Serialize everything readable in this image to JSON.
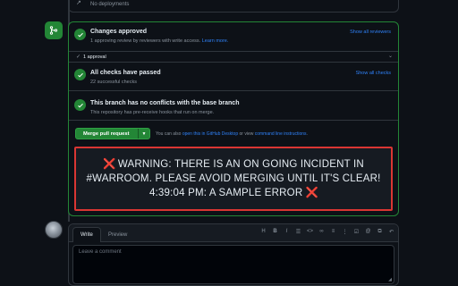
{
  "deployments": {
    "label": "No deployments"
  },
  "merge_box": {
    "approval": {
      "title": "Changes approved",
      "subtitle": "1 approving review by reviewers with write access.",
      "learn_more": "Learn more.",
      "show_all": "Show all reviewers",
      "count_label": "1 approval"
    },
    "checks": {
      "title": "All checks have passed",
      "subtitle": "22 successful checks",
      "show_all": "Show all checks"
    },
    "conflicts": {
      "title": "This branch has no conflicts with the base branch",
      "subtitle": "This repository has pre-receive hooks that run on merge."
    },
    "merge_button": {
      "label": "Merge pull request"
    },
    "alt_text": {
      "prefix": "You can also",
      "desktop_link": "open this in GitHub Desktop",
      "middle": "or view",
      "cli_link": "command line instructions",
      "suffix": "."
    },
    "warning": {
      "marks": "❌",
      "line1": "WARNING: THERE IS AN ON GOING INCIDENT IN",
      "line2": "#WARROOM. PLEASE AVOID MERGING UNTIL IT'S CLEAR!",
      "line3": "4:39:04 PM: A SAMPLE ERROR"
    }
  },
  "comment": {
    "tabs": [
      "Write",
      "Preview"
    ],
    "placeholder": "Leave a comment",
    "toolbar_icons": [
      "heading-icon",
      "bold-icon",
      "italic-icon",
      "quote-icon",
      "code-icon",
      "link-icon",
      "numbered-list-icon",
      "bulleted-list-icon",
      "task-list-icon",
      "mention-icon",
      "reference-icon",
      "reply-icon"
    ]
  },
  "colors": {
    "success": "#238636",
    "danger": "#da3633",
    "link": "#2f81f7",
    "bg": "#0d1117"
  }
}
